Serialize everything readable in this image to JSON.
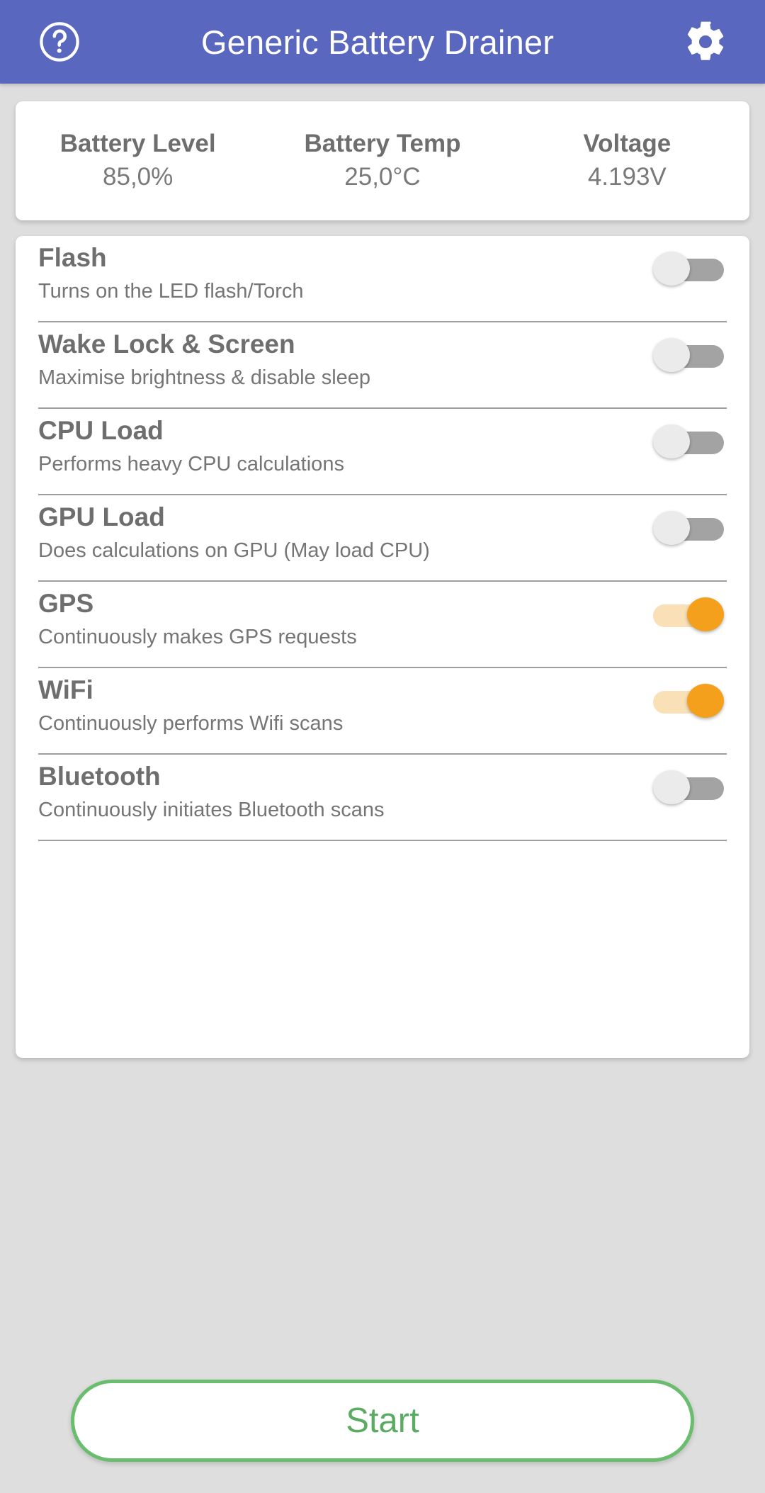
{
  "appbar": {
    "title": "Generic Battery Drainer",
    "help_icon": "help-circle-icon",
    "settings_icon": "gear-icon",
    "background_color": "#5a67be",
    "text_color": "#ffffff"
  },
  "status": {
    "cells": [
      {
        "label": "Battery Level",
        "value": "85,0%"
      },
      {
        "label": "Battery Temp",
        "value": "25,0°C"
      },
      {
        "label": "Voltage",
        "value": "4.193V"
      }
    ]
  },
  "toggles": {
    "on_color": "#f4a01c",
    "on_track_color": "#fae0b6",
    "off_thumb_color": "#ebebeb",
    "off_track_color": "#a3a3a3",
    "items": [
      {
        "title": "Flash",
        "subtitle": "Turns on the LED flash/Torch",
        "state": "off"
      },
      {
        "title": "Wake Lock & Screen",
        "subtitle": "Maximise brightness & disable sleep",
        "state": "off"
      },
      {
        "title": "CPU Load",
        "subtitle": "Performs heavy CPU calculations",
        "state": "off"
      },
      {
        "title": "GPU Load",
        "subtitle": "Does calculations on GPU (May load CPU)",
        "state": "off"
      },
      {
        "title": "GPS",
        "subtitle": "Continuously makes GPS requests",
        "state": "on"
      },
      {
        "title": "WiFi",
        "subtitle": "Continuously performs Wifi scans",
        "state": "on"
      },
      {
        "title": "Bluetooth",
        "subtitle": "Continuously initiates Bluetooth scans",
        "state": "off"
      }
    ]
  },
  "action": {
    "start_label": "Start",
    "border_color": "#6bbd6e",
    "text_color": "#5cab62"
  }
}
